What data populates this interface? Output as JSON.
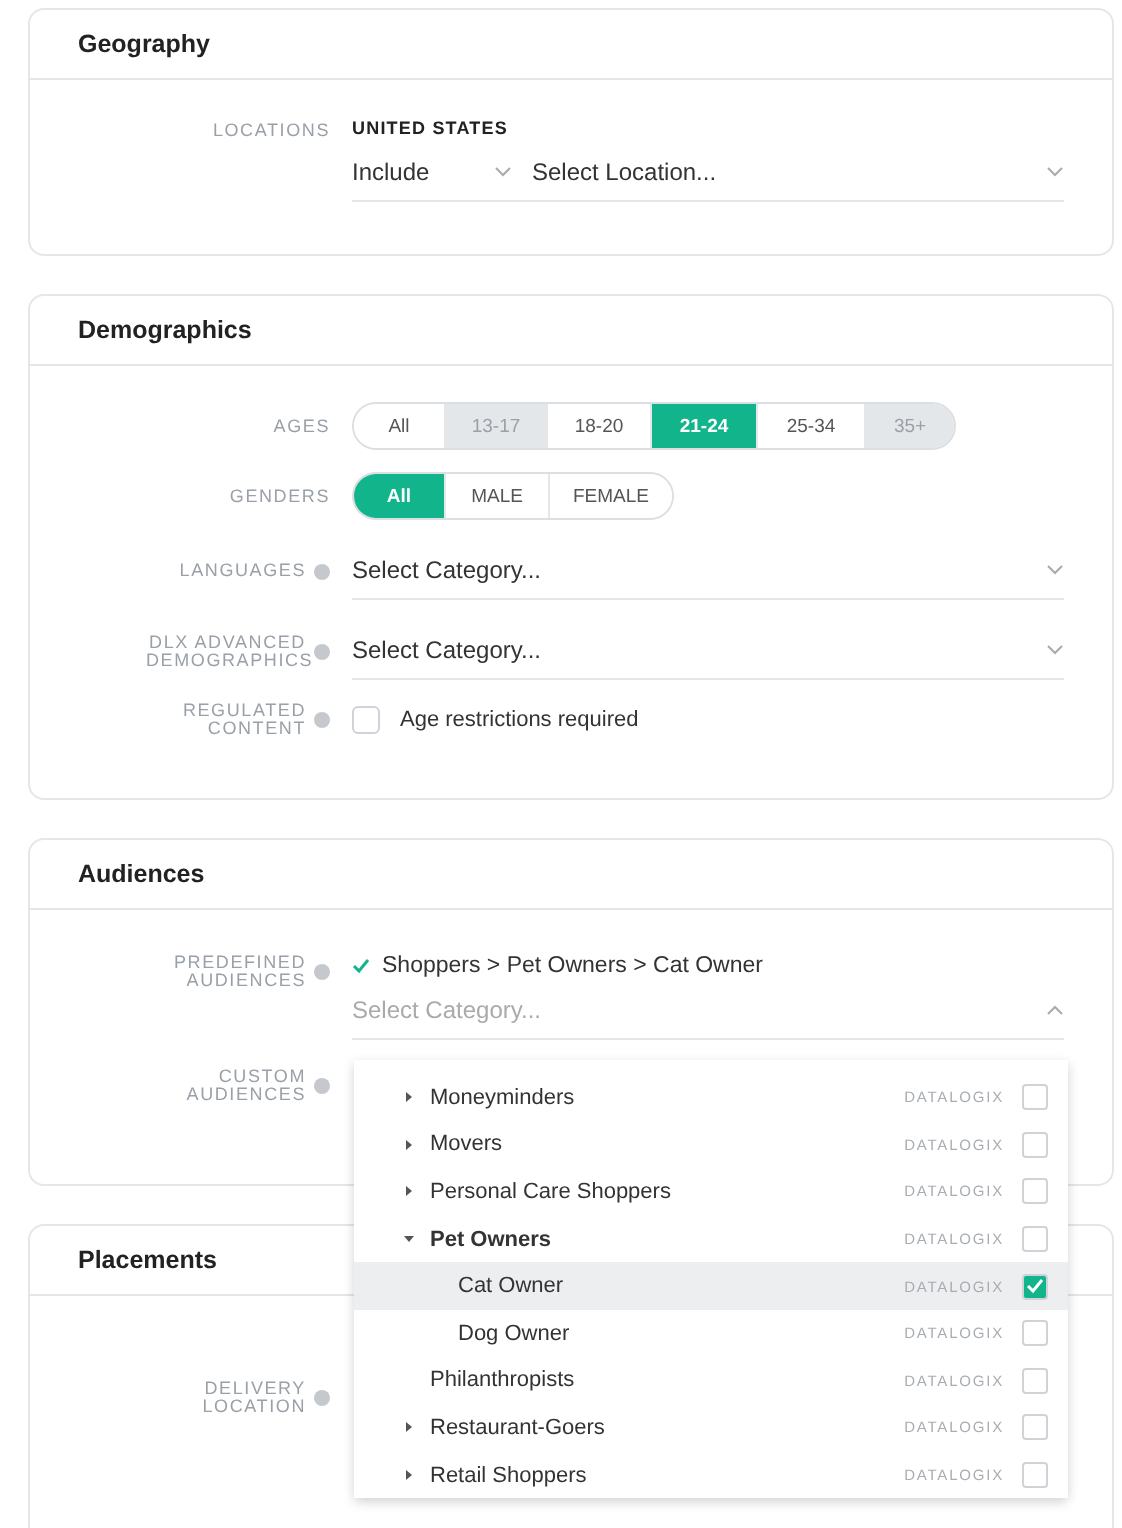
{
  "geography": {
    "title": "Geography",
    "locations": {
      "label": "LOCATIONS",
      "country": "UNITED STATES",
      "mode": "Include",
      "placeholder": "Select Location..."
    }
  },
  "demographics": {
    "title": "Demographics",
    "ages": {
      "label": "AGES",
      "options": [
        {
          "label": "All",
          "selected": false,
          "disabled": false
        },
        {
          "label": "13-17",
          "selected": false,
          "disabled": true
        },
        {
          "label": "18-20",
          "selected": false,
          "disabled": false
        },
        {
          "label": "21-24",
          "selected": true,
          "disabled": false
        },
        {
          "label": "25-34",
          "selected": false,
          "disabled": false
        },
        {
          "label": "35+",
          "selected": false,
          "disabled": true
        }
      ]
    },
    "genders": {
      "label": "GENDERS",
      "options": [
        {
          "label": "All",
          "selected": true,
          "disabled": false
        },
        {
          "label": "MALE",
          "selected": false,
          "disabled": false
        },
        {
          "label": "FEMALE",
          "selected": false,
          "disabled": false
        }
      ]
    },
    "languages": {
      "label": "LANGUAGES",
      "placeholder": "Select Category..."
    },
    "dlx": {
      "label": "DLX ADVANCED DEMOGRAPHICS",
      "placeholder": "Select Category..."
    },
    "regulated": {
      "label": "REGULATED CONTENT",
      "checkbox": "Age restrictions required",
      "checked": false
    }
  },
  "audiences": {
    "title": "Audiences",
    "predefined": {
      "label": "PREDEFINED AUDIENCES",
      "selection": "Shoppers > Pet Owners > Cat Owner",
      "placeholder": "Select Category...",
      "expanded": true
    },
    "custom": {
      "label": "CUSTOM AUDIENCES"
    },
    "dropdown": [
      {
        "label": "Moneyminders",
        "tag": "DATALOGIX",
        "checked": false,
        "expanded": false
      },
      {
        "label": "Movers",
        "tag": "DATALOGIX",
        "checked": false,
        "expanded": false
      },
      {
        "label": "Personal Care Shoppers",
        "tag": "DATALOGIX",
        "checked": false,
        "expanded": false
      },
      {
        "label": "Pet Owners",
        "tag": "DATALOGIX",
        "checked": false,
        "expanded": true,
        "children": [
          {
            "label": "Cat Owner",
            "tag": "DATALOGIX",
            "checked": true,
            "selected": true
          },
          {
            "label": "Dog Owner",
            "tag": "DATALOGIX",
            "checked": false,
            "selected": false
          }
        ]
      },
      {
        "label": "Philanthropists",
        "tag": "DATALOGIX",
        "checked": false
      },
      {
        "label": "Restaurant-Goers",
        "tag": "DATALOGIX",
        "checked": false,
        "expanded": false
      },
      {
        "label": "Retail Shoppers",
        "tag": "DATALOGIX",
        "checked": false,
        "expanded": false
      }
    ]
  },
  "placements": {
    "title": "Placements",
    "delivery": {
      "label": "DELIVERY LOCATION"
    }
  }
}
